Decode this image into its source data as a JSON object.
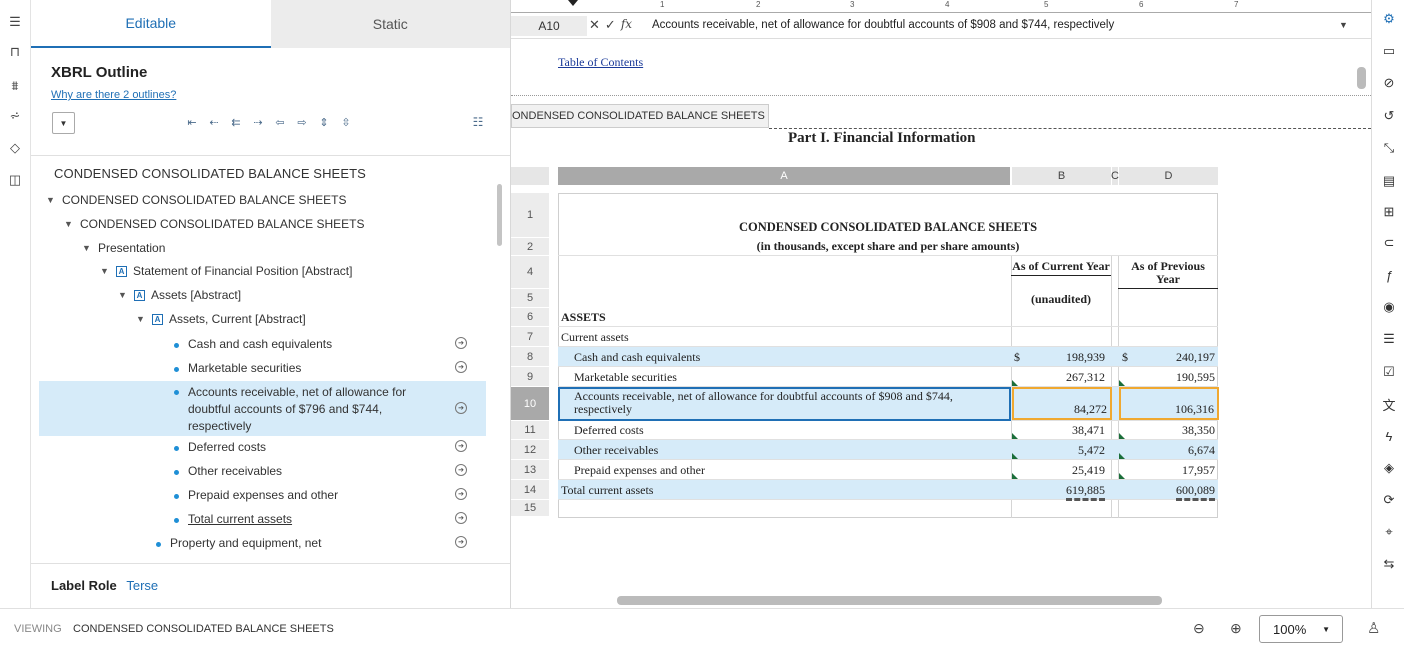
{
  "left_rail": {
    "icons": [
      "outline-icon",
      "bookmark-icon",
      "filter-x-icon",
      "filter-v-icon",
      "tags-icon",
      "comment-icon"
    ]
  },
  "outline": {
    "tabs": [
      {
        "label": "Editable"
      },
      {
        "label": "Static"
      }
    ],
    "title": "XBRL Outline",
    "why_link": "Why are there 2 outlines?",
    "heading": "CONDENSED CONSOLIDATED BALANCE SHEETS",
    "tree": [
      {
        "label": "CONDENSED CONSOLIDATED BALANCE SHEETS",
        "type": "caret"
      },
      {
        "label": "CONDENSED CONSOLIDATED BALANCE SHEETS",
        "type": "caret"
      },
      {
        "label": "Presentation",
        "type": "caret"
      },
      {
        "label": "Statement of Financial Position [Abstract]",
        "type": "abstract"
      },
      {
        "label": "Assets [Abstract]",
        "type": "abstract"
      },
      {
        "label": "Assets, Current [Abstract]",
        "type": "abstract"
      },
      {
        "label": "Cash and cash equivalents",
        "type": "item"
      },
      {
        "label": "Marketable securities",
        "type": "item"
      },
      {
        "label": "Accounts receivable, net of allowance for doubtful accounts of $796 and $744, respectively",
        "type": "item",
        "selected": true
      },
      {
        "label": "Deferred costs",
        "type": "item"
      },
      {
        "label": "Other receivables",
        "type": "item"
      },
      {
        "label": "Prepaid expenses and other",
        "type": "item"
      },
      {
        "label": "Total current assets",
        "type": "item",
        "underline": true
      },
      {
        "label": "Property and equipment, net",
        "type": "item"
      }
    ],
    "label_role": {
      "label": "Label Role",
      "value": "Terse"
    }
  },
  "status": {
    "viewing_label": "VIEWING",
    "viewing_value": "CONDENSED CONSOLIDATED BALANCE SHEETS",
    "zoom": "100%"
  },
  "sheet": {
    "ruler_nums": [
      "1",
      "2",
      "3",
      "4",
      "5",
      "6",
      "7"
    ],
    "cell_ref": "A10",
    "formula": "Accounts receivable, net of allowance for doubtful accounts of $908 and $744, respectively",
    "toc_link": "Table of Contents",
    "section_tab": "ONDENSED CONSOLIDATED BALANCE SHEETS",
    "part_title": "Part I. Financial Information",
    "columns": [
      "A",
      "B",
      "C",
      "D"
    ],
    "row_nums": [
      "1",
      "2",
      "4",
      "5",
      "6",
      "7",
      "8",
      "9",
      "10",
      "11",
      "12",
      "13",
      "14",
      "15"
    ],
    "title1": "CONDENSED CONSOLIDATED BALANCE SHEETS",
    "title2": "(in thousands, except share and per share amounts)",
    "col_b_header": "As of Current Year",
    "col_d_header": "As of Previous Year",
    "unaudited": "(unaudited)",
    "assets": "ASSETS",
    "current_assets": "Current assets",
    "rows": [
      {
        "label": "Cash and cash equivalents",
        "b": "198,939",
        "d": "240,197",
        "dollar": "$"
      },
      {
        "label": "Marketable securities",
        "b": "267,312",
        "d": "190,595"
      },
      {
        "label": "Accounts receivable, net of allowance for doubtful accounts of $908 and $744, respectively",
        "b": "84,272",
        "d": "106,316"
      },
      {
        "label": "Deferred costs",
        "b": "38,471",
        "d": "38,350"
      },
      {
        "label": "Other receivables",
        "b": "5,472",
        "d": "6,674"
      },
      {
        "label": "Prepaid expenses and other",
        "b": "25,419",
        "d": "17,957"
      },
      {
        "label": "Total current assets",
        "b": "619,885",
        "d": "600,089"
      }
    ]
  },
  "right_rail": {
    "icons": [
      "settings-icon",
      "comment-icon",
      "link-icon",
      "history-icon",
      "collapse-icon",
      "fx-doc-icon",
      "table-icon",
      "attachment-icon",
      "function-icon",
      "check-circle-icon",
      "layers-icon",
      "checklist-icon",
      "translate-icon",
      "bolt-icon",
      "tag-icon",
      "sync-icon",
      "location-icon",
      "transfer-icon"
    ]
  }
}
